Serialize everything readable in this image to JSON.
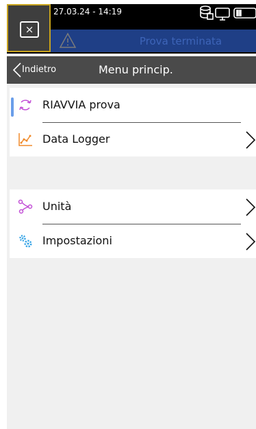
{
  "status": {
    "datetime": "27.03.24 - 14:19",
    "icons": [
      "database-icon",
      "display-icon",
      "battery-icon"
    ]
  },
  "warning": {
    "text": "Prova terminata",
    "icon": "warning-triangle-icon",
    "band_color": "#1f3f86",
    "text_color": "#3d64b8"
  },
  "close_button": {
    "icon": "close-icon",
    "label": "×",
    "border_color": "#c7a21c"
  },
  "nav": {
    "back_label": "Indietro",
    "title": "Menu princip."
  },
  "menu_groups": [
    {
      "items": [
        {
          "label": "RIAVVIA prova",
          "icon": "restart-icon",
          "icon_color": "#c24fd6",
          "selected": true,
          "has_chevron": false
        },
        {
          "label": "Data Logger",
          "icon": "line-chart-icon",
          "icon_color": "#f08a2a",
          "has_chevron": true
        }
      ]
    },
    {
      "items": [
        {
          "label": "Unità",
          "icon": "share-nodes-icon",
          "icon_color": "#c24fd6",
          "has_chevron": true
        },
        {
          "label": "Impostazioni",
          "icon": "gears-icon",
          "icon_color": "#36a4e6",
          "has_chevron": true
        }
      ]
    }
  ],
  "accent_color": "#6a9eea"
}
